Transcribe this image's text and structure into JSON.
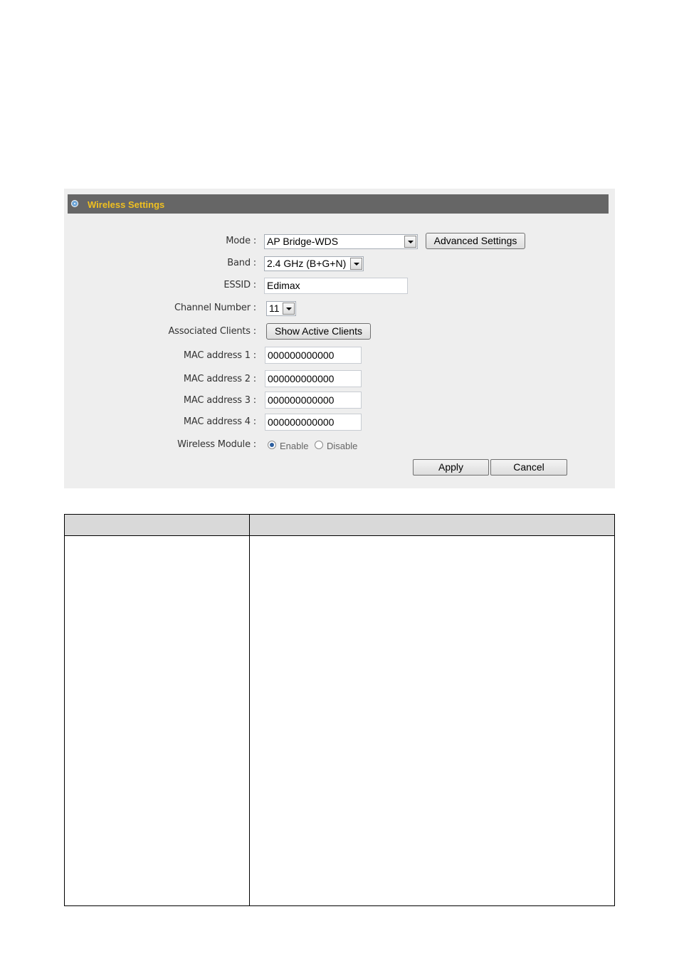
{
  "panel": {
    "title": "Wireless Settings",
    "mode": {
      "label": "Mode :",
      "value": "AP Bridge-WDS",
      "advanced_button": "Advanced Settings"
    },
    "band": {
      "label": "Band :",
      "value": "2.4 GHz (B+G+N)"
    },
    "essid": {
      "label": "ESSID :",
      "value": "Edimax"
    },
    "channel": {
      "label": "Channel Number :",
      "value": "11"
    },
    "clients": {
      "label": "Associated Clients :",
      "button": "Show Active Clients"
    },
    "mac": [
      {
        "label": "MAC address 1 :",
        "value": "000000000000"
      },
      {
        "label": "MAC address 2 :",
        "value": "000000000000"
      },
      {
        "label": "MAC address 3 :",
        "value": "000000000000"
      },
      {
        "label": "MAC address 4 :",
        "value": "000000000000"
      }
    ],
    "module": {
      "label": "Wireless Module :",
      "enable": "Enable",
      "disable": "Disable",
      "selected": "Enable"
    },
    "apply": "Apply",
    "cancel": "Cancel"
  },
  "table": {
    "headers": [
      "",
      ""
    ]
  },
  "colors": {
    "header_bg": "#666666",
    "title_text": "#f0c020",
    "panel_bg": "#eeeeee",
    "table_header_bg": "#d9d9d9"
  }
}
